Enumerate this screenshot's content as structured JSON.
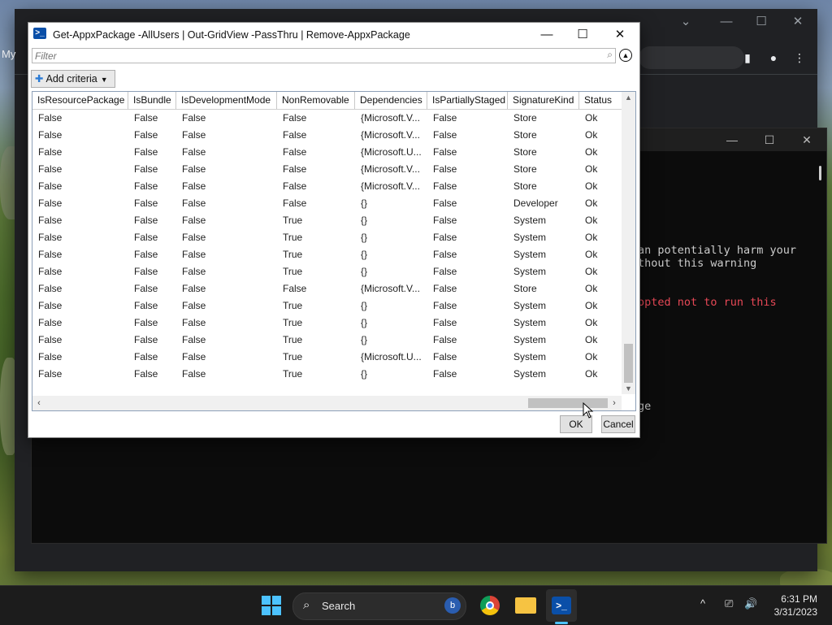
{
  "browser": {
    "partial_label": "My",
    "controls": [
      "⌄",
      "—",
      "☐",
      "✕"
    ]
  },
  "terminal": {
    "controls": [
      "—",
      "☐",
      "✕"
    ],
    "lines": [
      {
        "text": "an potentially harm your",
        "color": "white"
      },
      {
        "text": "thout this warning",
        "color": "white"
      },
      {
        "text": "opted not to run this",
        "color": "red"
      },
      {
        "text": "ge",
        "color": "white"
      }
    ]
  },
  "dialog": {
    "title": "Get-AppxPackage -AllUsers | Out-GridView -PassThru | Remove-AppxPackage",
    "minimize": "—",
    "maximize": "☐",
    "close": "✕",
    "filter_placeholder": "Filter",
    "add_criteria": "Add criteria",
    "ok": "OK",
    "cancel": "Cancel",
    "columns": [
      "IsResourcePackage",
      "IsBundle",
      "IsDevelopmentMode",
      "NonRemovable",
      "Dependencies",
      "IsPartiallyStaged",
      "SignatureKind",
      "Status"
    ],
    "rows": [
      [
        "False",
        "False",
        "False",
        "False",
        "{Microsoft.V...",
        "False",
        "Store",
        "Ok"
      ],
      [
        "False",
        "False",
        "False",
        "False",
        "{Microsoft.V...",
        "False",
        "Store",
        "Ok"
      ],
      [
        "False",
        "False",
        "False",
        "False",
        "{Microsoft.U...",
        "False",
        "Store",
        "Ok"
      ],
      [
        "False",
        "False",
        "False",
        "False",
        "{Microsoft.V...",
        "False",
        "Store",
        "Ok"
      ],
      [
        "False",
        "False",
        "False",
        "False",
        "{Microsoft.V...",
        "False",
        "Store",
        "Ok"
      ],
      [
        "False",
        "False",
        "False",
        "False",
        "{}",
        "False",
        "Developer",
        "Ok"
      ],
      [
        "False",
        "False",
        "False",
        "True",
        "{}",
        "False",
        "System",
        "Ok"
      ],
      [
        "False",
        "False",
        "False",
        "True",
        "{}",
        "False",
        "System",
        "Ok"
      ],
      [
        "False",
        "False",
        "False",
        "True",
        "{}",
        "False",
        "System",
        "Ok"
      ],
      [
        "False",
        "False",
        "False",
        "True",
        "{}",
        "False",
        "System",
        "Ok"
      ],
      [
        "False",
        "False",
        "False",
        "False",
        "{Microsoft.V...",
        "False",
        "Store",
        "Ok"
      ],
      [
        "False",
        "False",
        "False",
        "True",
        "{}",
        "False",
        "System",
        "Ok"
      ],
      [
        "False",
        "False",
        "False",
        "True",
        "{}",
        "False",
        "System",
        "Ok"
      ],
      [
        "False",
        "False",
        "False",
        "True",
        "{}",
        "False",
        "System",
        "Ok"
      ],
      [
        "False",
        "False",
        "False",
        "True",
        "{Microsoft.U...",
        "False",
        "System",
        "Ok"
      ],
      [
        "False",
        "False",
        "False",
        "True",
        "{}",
        "False",
        "System",
        "Ok"
      ]
    ]
  },
  "taskbar": {
    "search_label": "Search",
    "apps": [
      "start-icon",
      "chrome-icon",
      "file-explorer-icon",
      "powershell-icon"
    ],
    "tray": {
      "chevron": "^",
      "network": "⎚",
      "volume": "🔊"
    },
    "time": "6:31 PM",
    "date": "3/31/2023"
  },
  "colors": {
    "accent": "#4cc2ff",
    "terminal_red": "#e74856",
    "powershell_blue": "#0a4fa8"
  }
}
